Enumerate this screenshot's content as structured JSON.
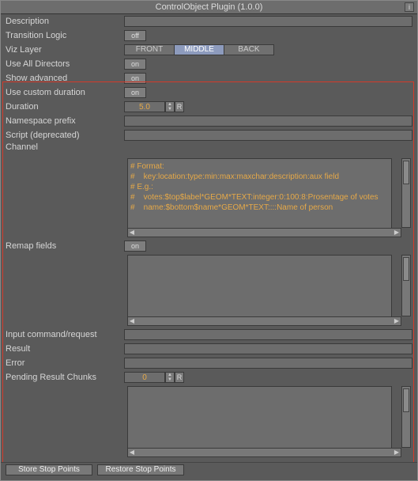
{
  "title": "ControlObject Plugin (1.0.0)",
  "info_icon": "i",
  "labels": {
    "description": "Description",
    "transition_logic": "Transition Logic",
    "viz_layer": "Viz Layer",
    "use_all_directors": "Use All Directors",
    "show_advanced": "Show advanced",
    "use_custom_duration": "Use custom duration",
    "duration": "Duration",
    "namespace_prefix": "Namespace prefix",
    "script_deprecated": "Script (deprecated)",
    "channel": "Channel",
    "remap_fields": "Remap fields",
    "input_command": "Input command/request",
    "result": "Result",
    "error": "Error",
    "pending_result_chunks": "Pending Result Chunks"
  },
  "values": {
    "description": "",
    "transition_logic": "off",
    "viz_layer_options": [
      "FRONT",
      "MIDDLE",
      "BACK"
    ],
    "viz_layer_selected": "MIDDLE",
    "use_all_directors": "on",
    "show_advanced": "on",
    "use_custom_duration": "on",
    "duration": "5.0",
    "namespace_prefix": "",
    "script_deprecated": "",
    "channel_text": "# Format:\n#    key:location:type:min:max:maxchar:description:aux field\n# E.g.:\n#    votes:$top$label*GEOM*TEXT:integer:0:100:8:Prosentage of votes\n#    name:$bottom$name*GEOM*TEXT::::Name of person",
    "remap_fields": "on",
    "remap_text": "",
    "input_command": "",
    "result": "",
    "error": "",
    "pending_result_chunks": "0",
    "pending_text": ""
  },
  "footer": {
    "store": "Store Stop Points",
    "restore": "Restore Stop Points"
  }
}
